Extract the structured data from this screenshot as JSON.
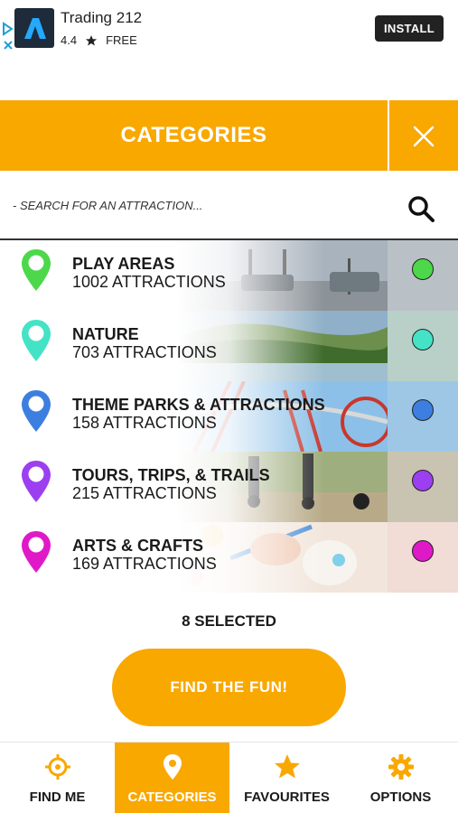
{
  "ad": {
    "app_name": "Trading 212",
    "rating": "4.4",
    "price": "FREE",
    "install_label": "INSTALL",
    "icons": [
      "adchoices-icon",
      "trading-logo-icon",
      "star-icon"
    ]
  },
  "header": {
    "title": "CATEGORIES",
    "close_icon": "close-icon"
  },
  "search": {
    "placeholder": "- SEARCH FOR AN ATTRACTION...",
    "icon": "search-icon"
  },
  "categories": [
    {
      "name": "PLAY AREAS",
      "count": "1002 ATTRACTIONS",
      "color": "#4cd84a",
      "image": "playground swings"
    },
    {
      "name": "NATURE",
      "count": "703 ATTRACTIONS",
      "color": "#44e3c6",
      "image": "lake and forest"
    },
    {
      "name": "THEME PARKS & ATTRACTIONS",
      "count": "158 ATTRACTIONS",
      "color": "#3d7fe0",
      "image": "roller coaster"
    },
    {
      "name": "TOURS, TRIPS, & TRAILS",
      "count": "215 ATTRACTIONS",
      "color": "#9b3ff0",
      "image": "segway riders"
    },
    {
      "name": "ARTS & CRAFTS",
      "count": "169 ATTRACTIONS",
      "color": "#e019c8",
      "image": "painting pottery"
    }
  ],
  "selection": {
    "label": "8 SELECTED"
  },
  "cta": {
    "label": "FIND THE FUN!"
  },
  "nav": [
    {
      "label": "FIND ME",
      "icon": "crosshair-icon",
      "active": false
    },
    {
      "label": "CATEGORIES",
      "icon": "map-pin-icon",
      "active": true
    },
    {
      "label": "FAVOURITES",
      "icon": "star-icon",
      "active": false
    },
    {
      "label": "OPTIONS",
      "icon": "gear-icon",
      "active": false
    }
  ],
  "colors": {
    "accent": "#f9a800",
    "text": "#1a1a1a"
  }
}
